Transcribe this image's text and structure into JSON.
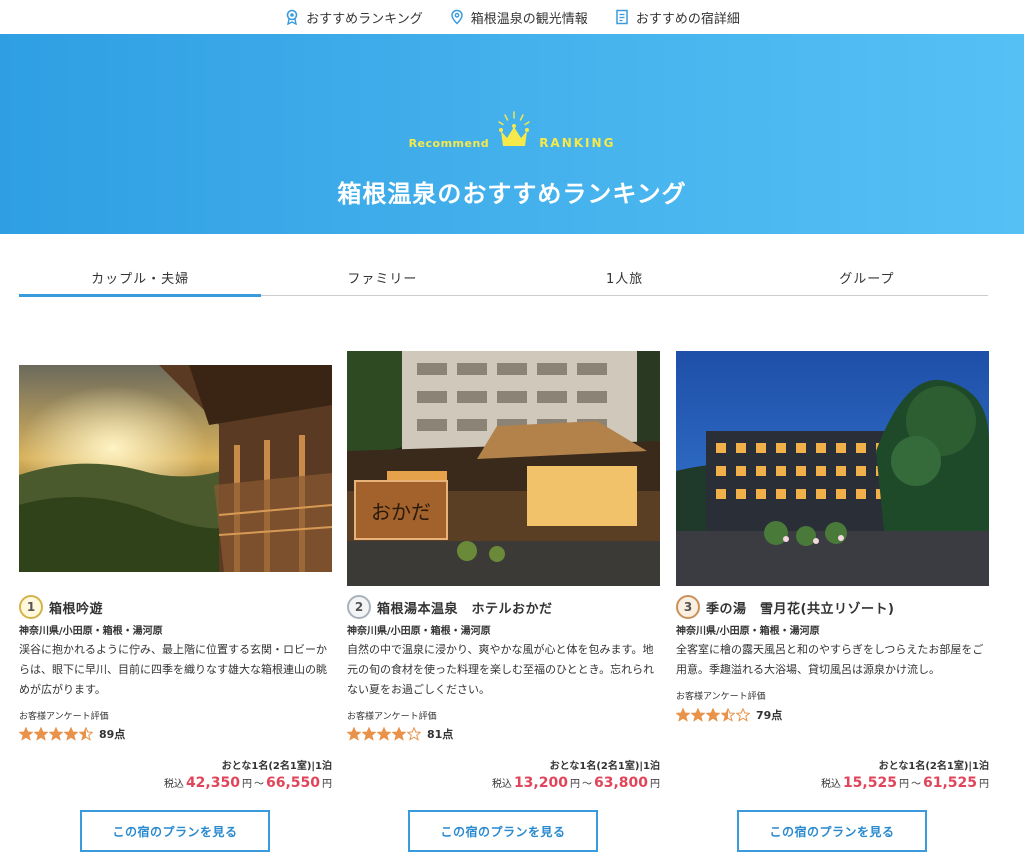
{
  "topnav": [
    {
      "label": "おすすめランキング",
      "icon": "ribbon-icon"
    },
    {
      "label": "箱根温泉の観光情報",
      "icon": "map-pin-icon"
    },
    {
      "label": "おすすめの宿詳細",
      "icon": "document-icon"
    }
  ],
  "hero": {
    "badge_left": "Recommend",
    "badge_right": "RANKING",
    "title": "箱根温泉のおすすめランキング"
  },
  "tabs": [
    {
      "label": "カップル・夫婦",
      "active": true
    },
    {
      "label": "ファミリー",
      "active": false
    },
    {
      "label": "1人旅",
      "active": false
    },
    {
      "label": "グループ",
      "active": false
    }
  ],
  "hotels": [
    {
      "rank": "1",
      "name": "箱根吟遊",
      "area": "神奈川県/小田原・箱根・湯河原",
      "description": "渓谷に抱かれるように佇み、最上階に位置する玄関・ロビーからは、眼下に早川、目前に四季を織りなす雄大な箱根連山の眺めが広がります。",
      "review_label": "お客様アンケート評価",
      "rating": 4.5,
      "score": "89点",
      "guests": "おとな1名(2名1室)|1泊",
      "tax": "税込",
      "price_min": "42,350",
      "price_max": "66,550",
      "yen": "円",
      "tilde": "～",
      "button": "この宿のプランを見る"
    },
    {
      "rank": "2",
      "name": "箱根湯本温泉　ホテルおかだ",
      "area": "神奈川県/小田原・箱根・湯河原",
      "description": "自然の中で温泉に浸かり、爽やかな風が心と体を包みます。地元の旬の食材を使った料理を楽しむ至福のひととき。忘れられない夏をお過ごしください。",
      "review_label": "お客様アンケート評価",
      "rating": 4,
      "score": "81点",
      "guests": "おとな1名(2名1室)|1泊",
      "tax": "税込",
      "price_min": "13,200",
      "price_max": "63,800",
      "yen": "円",
      "tilde": "～",
      "button": "この宿のプランを見る"
    },
    {
      "rank": "3",
      "name": "季の湯　雪月花(共立リゾート)",
      "area": "神奈川県/小田原・箱根・湯河原",
      "description": "全客室に檜の露天風呂と和のやすらぎをしつらえたお部屋をご用意。季趣溢れる大浴場、貸切風呂は源泉かけ流し。",
      "review_label": "お客様アンケート評価",
      "rating": 3.5,
      "score": "79点",
      "guests": "おとな1名(2名1室)|1泊",
      "tax": "税込",
      "price_min": "15,525",
      "price_max": "61,525",
      "yen": "円",
      "tilde": "～",
      "button": "この宿のプランを見る"
    }
  ],
  "colors": {
    "accent": "#3a9bdc",
    "price": "#e0455a",
    "star": "#e8924a",
    "hero": "#48b4ee"
  }
}
